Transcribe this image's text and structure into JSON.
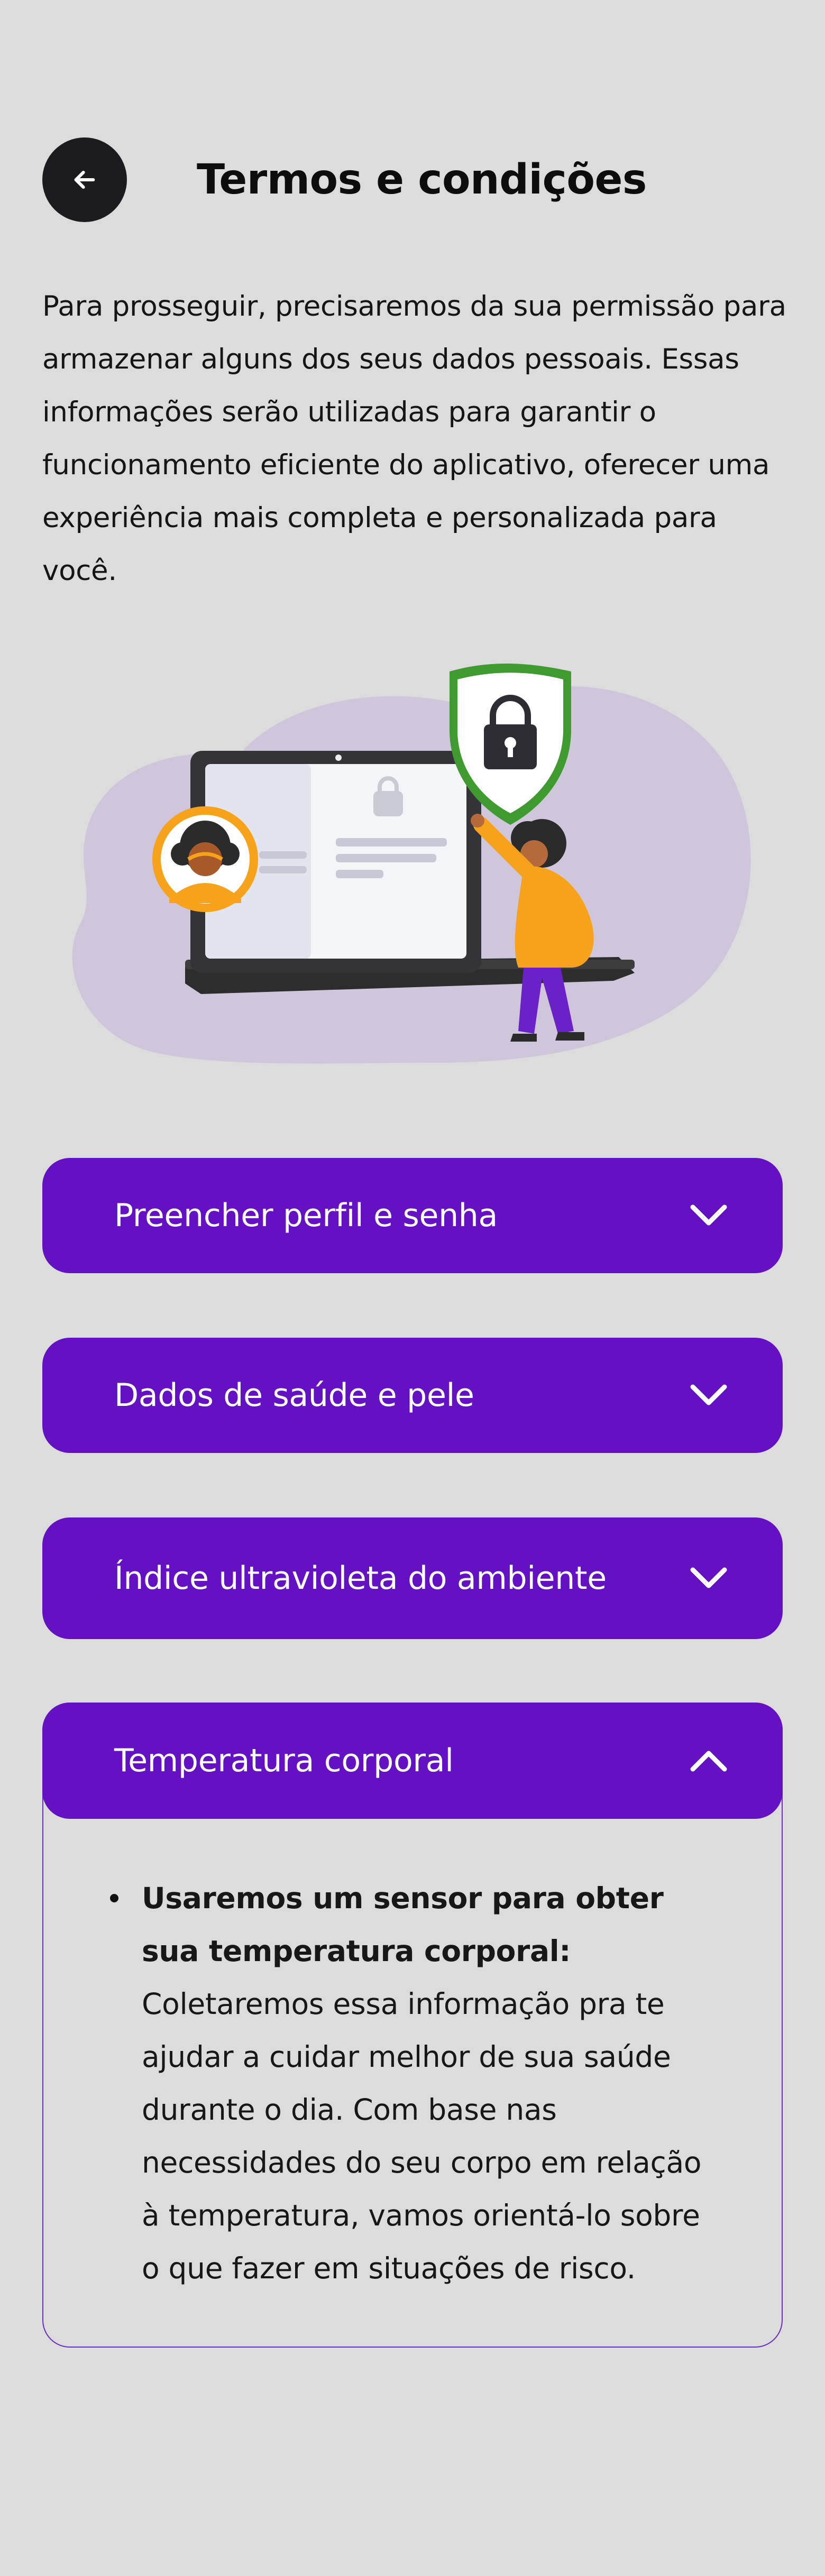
{
  "header": {
    "title": "Termos e condições",
    "back_icon": "arrow-left-icon"
  },
  "intro_text": "Para prosseguir, precisaremos da sua permissão para armazenar alguns dos seus dados pessoais. Essas informações serão utilizadas para garantir o funcionamento eficiente do aplicativo, oferecer uma experiência mais completa e personalizada para você.",
  "colors": {
    "background": "#dcdcdc",
    "accent": "#6411c4",
    "text": "#111111"
  },
  "accordions": [
    {
      "label": "Preencher perfil e senha",
      "expanded": false,
      "icon": "chevron-down-icon"
    },
    {
      "label": "Dados de saúde e pele",
      "expanded": false,
      "icon": "chevron-down-icon"
    },
    {
      "label": "Índice ultravioleta do ambiente",
      "expanded": false,
      "icon": "chevron-down-icon"
    },
    {
      "label": "Temperatura corporal",
      "expanded": true,
      "icon": "chevron-up-icon",
      "content": {
        "bold": "Usaremos um sensor para obter sua temperatura corporal:",
        "text": " Coletaremos essa informação pra te ajudar a cuidar melhor de sua saúde durante o dia. Com base nas necessidades do seu corpo em relação à temperatura, vamos orientá-lo sobre o que fazer em situações de risco."
      }
    }
  ]
}
